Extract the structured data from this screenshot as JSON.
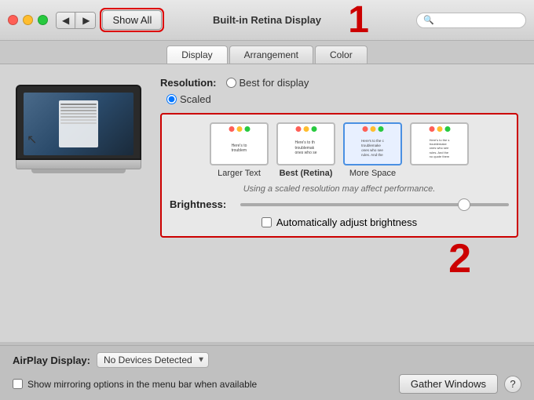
{
  "window": {
    "title": "Built-in Retina Display"
  },
  "titlebar": {
    "show_all_label": "Show All",
    "search_placeholder": ""
  },
  "tabs": [
    {
      "id": "display",
      "label": "Display",
      "active": true
    },
    {
      "id": "arrangement",
      "label": "Arrangement",
      "active": false
    },
    {
      "id": "color",
      "label": "Color",
      "active": false
    }
  ],
  "resolution": {
    "label": "Resolution:",
    "options": [
      {
        "id": "best",
        "label": "Best for display",
        "selected": false
      },
      {
        "id": "scaled",
        "label": "Scaled",
        "selected": true
      }
    ]
  },
  "scaled_options": [
    {
      "id": "larger",
      "label": "Larger Text",
      "selected": false
    },
    {
      "id": "best_retina",
      "label": "Best (Retina)",
      "selected": true
    },
    {
      "id": "more_space",
      "label": "More Space",
      "selected": false
    },
    {
      "id": "extra",
      "label": "",
      "selected": false
    }
  ],
  "perf_note": "Using a scaled resolution may affect performance.",
  "brightness": {
    "label": "Brightness:",
    "value": 85,
    "auto_label": "Automatically adjust brightness"
  },
  "airplay": {
    "label": "AirPlay Display:",
    "value": "No Devices Detected",
    "options": [
      "No Devices Detected"
    ]
  },
  "mirror_check": {
    "label": "Show mirroring options in the menu bar when available",
    "checked": false
  },
  "gather_windows_label": "Gather Windows",
  "help_label": "?",
  "label1": "1",
  "label2": "2"
}
